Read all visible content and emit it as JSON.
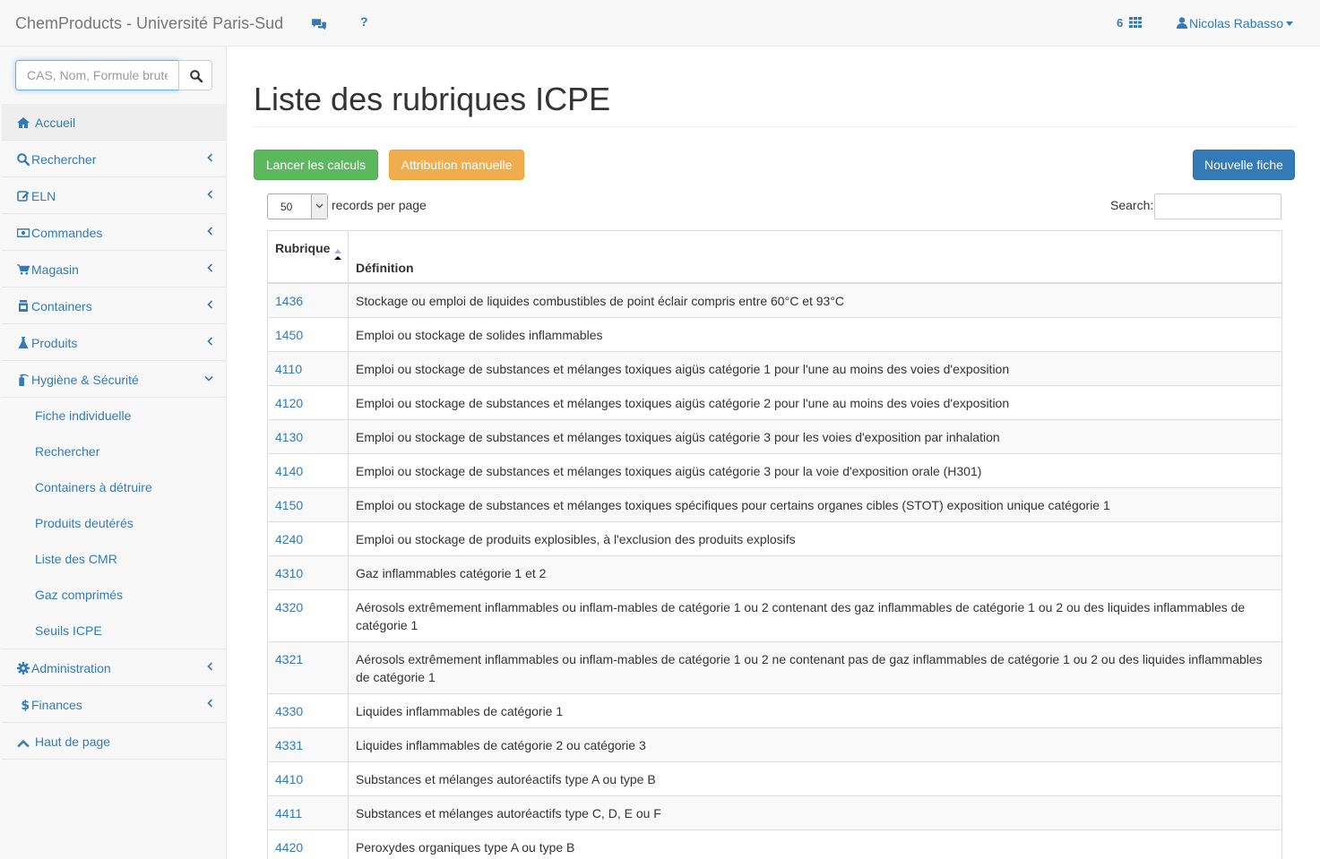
{
  "navbar": {
    "brand": "ChemProducts - Université Paris-Sud",
    "help_label": "?",
    "apps_count": "6",
    "user_name": "Nicolas Rabasso"
  },
  "sidebar": {
    "search_placeholder": "CAS, Nom, Formule brute",
    "items": [
      {
        "label": "Accueil",
        "icon": "home-icon"
      },
      {
        "label": "Rechercher",
        "icon": "search-icon"
      },
      {
        "label": "ELN",
        "icon": "edit-icon"
      },
      {
        "label": "Commandes",
        "icon": "money-icon"
      },
      {
        "label": "Magasin",
        "icon": "cart-icon"
      },
      {
        "label": "Containers",
        "icon": "container-icon"
      },
      {
        "label": "Produits",
        "icon": "flask-icon"
      },
      {
        "label": "Hygiène & Sécurité",
        "icon": "extinguisher-icon"
      },
      {
        "label": "Administration",
        "icon": "gear-icon"
      },
      {
        "label": "Finances",
        "icon": "dollar-icon"
      },
      {
        "label": "Haut de page",
        "icon": "chevron-up-icon"
      }
    ],
    "submenu": [
      "Fiche individuelle",
      "Rechercher",
      "Containers à détruire",
      "Produits deutérés",
      "Liste des CMR",
      "Gaz comprimés",
      "Seuils ICPE"
    ]
  },
  "main": {
    "title": "Liste des rubriques ICPE",
    "buttons": {
      "run": "Lancer les calculs",
      "manual": "Attribution manuelle",
      "new": "Nouvelle fiche"
    },
    "length": {
      "value": "50",
      "label": "records per page"
    },
    "search_label": "Search:",
    "table": {
      "columns": [
        "Rubrique",
        "Définition"
      ],
      "rows": [
        {
          "code": "1436",
          "definition": "Stockage ou emploi de liquides combustibles de point éclair compris entre 60°C et 93°C"
        },
        {
          "code": "1450",
          "definition": "Emploi ou stockage de solides inflammables"
        },
        {
          "code": "4110",
          "definition": "Emploi ou stockage de substances et mélanges toxiques aigüs catégorie 1 pour l'une au moins des voies d'exposition"
        },
        {
          "code": "4120",
          "definition": "Emploi ou stockage de substances et mélanges toxiques aigüs catégorie 2 pour l'une au moins des voies d'exposition"
        },
        {
          "code": "4130",
          "definition": "Emploi ou stockage de substances et mélanges toxiques aigüs catégorie 3 pour les voies d'exposition par inhalation"
        },
        {
          "code": "4140",
          "definition": "Emploi ou stockage de substances et mélanges toxiques aigüs catégorie 3 pour la voie d'exposition orale (H301)"
        },
        {
          "code": "4150",
          "definition": "Emploi ou stockage de substances et mélanges toxiques spécifiques pour certains organes cibles (STOT) exposition unique catégorie 1"
        },
        {
          "code": "4240",
          "definition": "Emploi ou stockage de produits explosibles, à l'exclusion des produits explosifs"
        },
        {
          "code": "4310",
          "definition": "Gaz inflammables catégorie 1 et 2"
        },
        {
          "code": "4320",
          "definition": "Aérosols extrêmement inflammables ou inflam-mables de catégorie 1 ou 2 contenant des gaz inflammables de catégorie 1 ou 2 ou des liquides inflammables de catégorie 1"
        },
        {
          "code": "4321",
          "definition": "Aérosols extrêmement inflammables ou inflam-mables de catégorie 1 ou 2 ne contenant pas de gaz inflammables de catégorie 1 ou 2 ou des liquides inflammables de catégorie 1"
        },
        {
          "code": "4330",
          "definition": "Liquides inflammables de catégorie 1"
        },
        {
          "code": "4331",
          "definition": "Liquides inflammables de catégorie 2 ou catégorie 3"
        },
        {
          "code": "4410",
          "definition": "Substances et mélanges autoréactifs type A ou type B"
        },
        {
          "code": "4411",
          "definition": "Substances et mélanges autoréactifs type C, D, E ou F"
        },
        {
          "code": "4420",
          "definition": "Peroxydes organiques type A ou type B"
        },
        {
          "code": "",
          "definition": ""
        }
      ]
    }
  },
  "colors": {
    "link": "#337ab7",
    "success": "#5cb85c",
    "warning": "#f0ad4e",
    "primary": "#337ab7"
  }
}
